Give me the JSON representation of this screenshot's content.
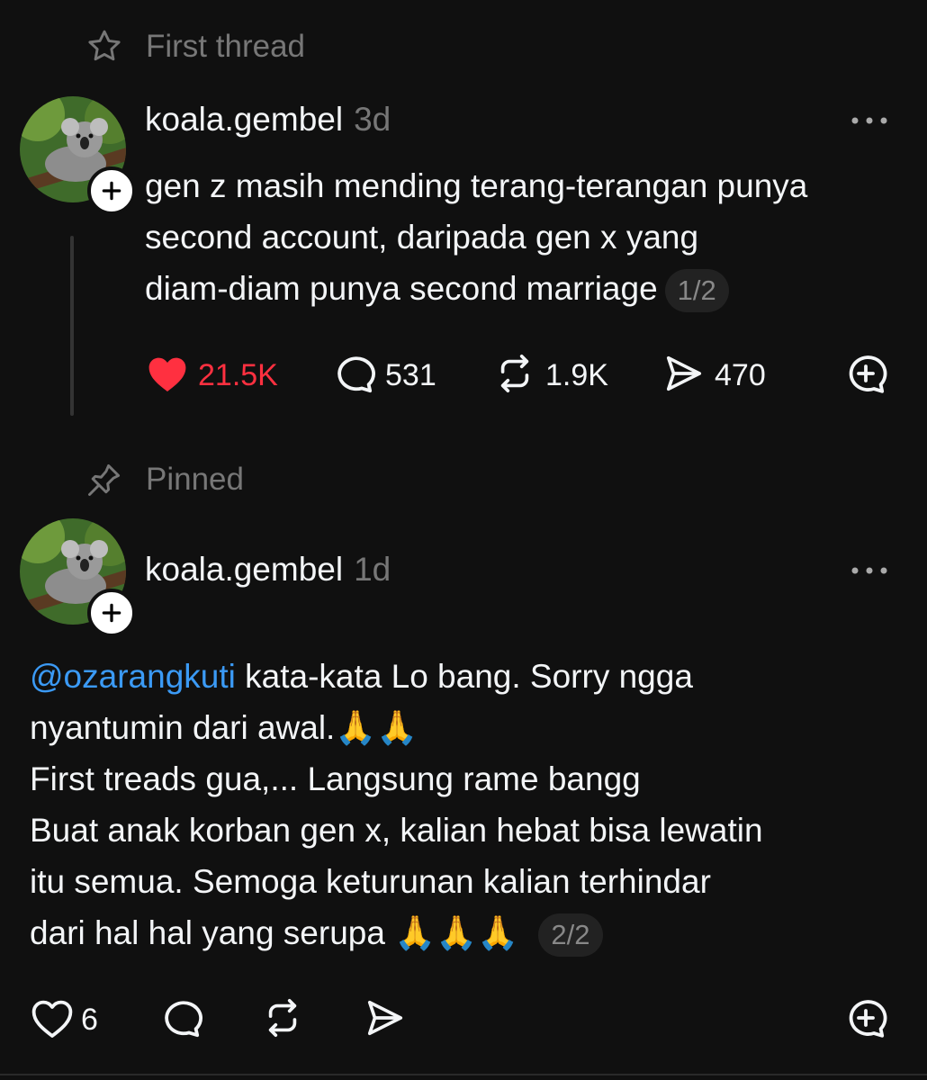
{
  "first_thread_label": "First thread",
  "pinned_label": "Pinned",
  "post1": {
    "username": "koala.gembel",
    "time": "3d",
    "lines": [
      "gen z masih mending terang-terangan punya",
      "second account, daripada gen x yang",
      "diam-diam punya second marriage"
    ],
    "thread_index": "1/2",
    "likes": "21.5K",
    "replies": "531",
    "reposts": "1.9K",
    "shares": "470",
    "liked": true
  },
  "post2": {
    "username": "koala.gembel",
    "time": "1d",
    "mention": "@ozarangkuti",
    "line1_rest": " kata-kata Lo bang. Sorry ngga",
    "line2": "nyantumin dari awal.🙏🙏",
    "line3": "First treads gua,... Langsung rame bangg",
    "line4": "Buat anak korban gen x, kalian hebat bisa lewatin",
    "line5": "itu semua. Semoga keturunan kalian terhindar",
    "line6": "dari hal hal yang serupa 🙏🙏🙏",
    "thread_index": "2/2",
    "likes": "6"
  },
  "icons": {
    "star": "star-icon",
    "pin": "pin-icon",
    "more": "more-icon",
    "heart": "heart-icon",
    "reply": "reply-icon",
    "repost": "repost-icon",
    "share": "share-icon",
    "quote": "quote-add-icon"
  },
  "colors": {
    "background": "#101010",
    "like_active": "#ff3040",
    "mention": "#3b9af5",
    "muted": "#777777"
  }
}
